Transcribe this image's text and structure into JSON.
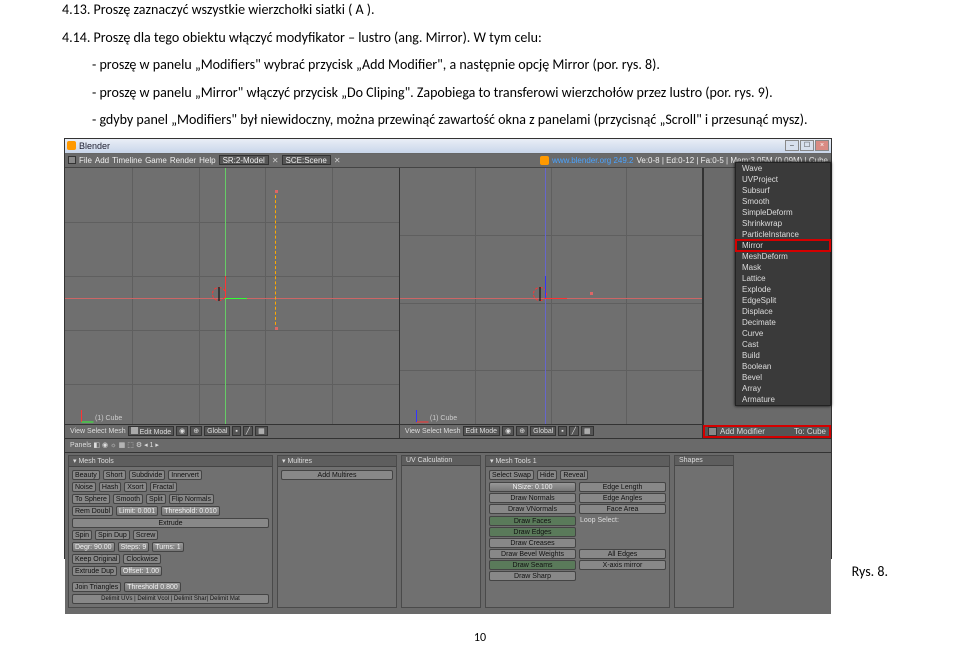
{
  "doc": {
    "line1": "4.13.  Proszę zaznaczyć wszystkie wierzchołki siatki ( A ).",
    "line2": "4.14.  Proszę dla tego obiektu włączyć modyfikator – lustro (ang. Mirror). W tym celu:",
    "bullet1": "- proszę w panelu „Modifiers\" wybrać przycisk „Add Modifier\", a następnie opcję Mirror (por. rys. 8).",
    "bullet2": "- proszę w panelu „Mirror\" włączyć przycisk „Do Cliping\". Zapobiega to transferowi wierzchołów przez lustro (por. rys. 9).",
    "bullet3": "- gdyby panel „Modifiers\" był niewidoczny, można przewinąć zawartość okna z panelami (przycisnąć „Scroll\" i przesunąć mysz).",
    "caption": "Rys. 8.",
    "pagenum": "10"
  },
  "blender": {
    "title": "Blender",
    "top_menu": [
      "File",
      "Add",
      "Timeline",
      "Game",
      "Render",
      "Help"
    ],
    "scr_scene": "SCE:Scene",
    "sr_model": "SR:2-Model",
    "site": "www.blender.org 249.2",
    "stats": "Ve:0-8 | Ed:0-12 | Fa:0-5 | Mem:3.05M (0.09M) | Cube",
    "vp_label": "(1) Cube",
    "vp_header": [
      "View",
      "Select",
      "Mesh"
    ],
    "edit_mode": "Edit Mode",
    "global_lbl": "Global",
    "modifier_menu": [
      "Wave",
      "UVProject",
      "Subsurf",
      "Smooth",
      "SimpleDeform",
      "Shrinkwrap",
      "ParticleInstance",
      "Mirror",
      "MeshDeform",
      "Mask",
      "Lattice",
      "Explode",
      "EdgeSplit",
      "Displace",
      "Decimate",
      "Curve",
      "Cast",
      "Build",
      "Boolean",
      "Bevel",
      "Array",
      "Armature"
    ],
    "add_modifier": "Add Modifier",
    "to_cube": "To: Cube",
    "buttons_header": {
      "panels": "Panels"
    },
    "panel_meshtools": {
      "title": "Mesh Tools",
      "row1": [
        "Beauty",
        "Short",
        "Subdivide",
        "Innervert"
      ],
      "row2": [
        "Noise",
        "Hash",
        "Xsort",
        "Fractal"
      ],
      "row3": [
        "To Sphere",
        "Smooth",
        "Split",
        "Flip Normals"
      ],
      "limit": "Limit: 0.001",
      "rem": "Rem Doubl",
      "thr": "Threshold: 0.010",
      "extrude": "Extrude",
      "row5": [
        "Spin",
        "Spin Dup",
        "Screw"
      ],
      "deg": "Degr: 90.00",
      "steps": "Steps: 9",
      "turns": "Turns: 1",
      "keep": "Keep Original",
      "clockwise": "Clockwise",
      "extrude_dup": "Extrude Dup",
      "offset": "Offset: 1.00",
      "join": "Join Triangles",
      "thresh": "Threshold 0.800",
      "delimit": "Delimit UVs | Delimit Vcol | Delimit Shar| Delimit Mat"
    },
    "panel_multires": {
      "title": "Multires",
      "btn": "Add Multires"
    },
    "panel_uvcalc": {
      "title": "UV Calculation"
    },
    "panel_meshtools1": {
      "title": "Mesh Tools 1",
      "sel": "Select Swap",
      "hide": "Hide",
      "rev": "Reveal",
      "nsize": "NSize: 0.100",
      "drawn": "Draw Normals",
      "drawvn": "Draw VNormals",
      "faces": "Draw Faces",
      "edges": "Draw Edges",
      "creases": "Draw Creases",
      "bevel": "Draw Bevel Weights",
      "seams": "Draw Seams",
      "sharp": "Draw Sharp",
      "edgelen": "Edge Length",
      "edgeang": "Edge Angles",
      "facearea": "Face Area",
      "alledges": "All Edges",
      "xaxis": "X-axis mirror",
      "loopsel": "Loop Select:"
    },
    "panel_shapes": {
      "title": "Shapes"
    }
  }
}
